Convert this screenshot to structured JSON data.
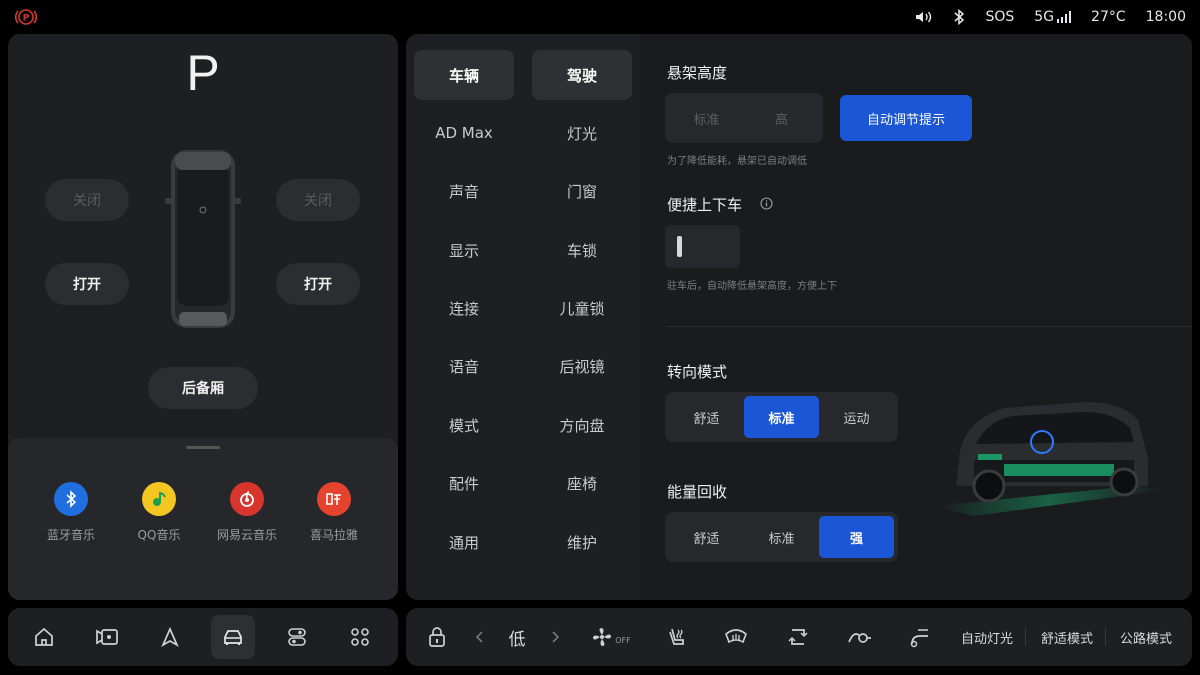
{
  "status": {
    "sos": "SOS",
    "network": "5G",
    "temperature": "27°C",
    "time": "18:00",
    "icons": [
      "parking-brake-icon",
      "volume-icon",
      "bluetooth-icon",
      "signal-icon"
    ]
  },
  "vehicle": {
    "gear": "P",
    "left_upper": "关闭",
    "right_upper": "关闭",
    "left_lower": "打开",
    "right_lower": "打开",
    "trunk": "后备厢"
  },
  "media_apps": [
    {
      "label": "蓝牙音乐",
      "icon": "bluetooth-icon",
      "color": "#1f6fe0"
    },
    {
      "label": "QQ音乐",
      "icon": "qq-music-icon",
      "color": "#f4c622"
    },
    {
      "label": "网易云音乐",
      "icon": "netease-music-icon",
      "color": "#d8362c"
    },
    {
      "label": "喜马拉雅",
      "icon": "ximalaya-icon",
      "color": "#e5432d"
    }
  ],
  "dock": {
    "items": [
      "home-icon",
      "camera-icon",
      "navigation-icon",
      "car-icon",
      "toggle-icon",
      "apps-grid-icon"
    ],
    "active": "car-icon"
  },
  "nav": {
    "col1": [
      "车辆",
      "AD Max",
      "声音",
      "显示",
      "连接",
      "语音",
      "模式",
      "配件",
      "通用"
    ],
    "col2": [
      "驾驶",
      "灯光",
      "门窗",
      "车锁",
      "儿童锁",
      "后视镜",
      "方向盘",
      "座椅",
      "维护"
    ],
    "selected_col1": "车辆",
    "selected_col2": "驾驶"
  },
  "suspension": {
    "title": "悬架高度",
    "options": [
      "标准",
      "高"
    ],
    "auto_button": "自动调节提示",
    "hint": "为了降低能耗，悬架已自动调低"
  },
  "easy_entry": {
    "title": "便捷上下车",
    "hint": "驻车后，自动降低悬架高度，方便上下"
  },
  "steering": {
    "title": "转向模式",
    "options": [
      "舒适",
      "标准",
      "运动"
    ],
    "selected": "标准"
  },
  "regen": {
    "title": "能量回收",
    "options": [
      "舒适",
      "标准",
      "强"
    ],
    "selected": "强"
  },
  "controls": {
    "fan_level": "低",
    "fan_state": "OFF",
    "auto_lights": "自动灯光",
    "comfort_mode": "舒适模式",
    "road_mode": "公路模式"
  },
  "colors": {
    "accent": "#1b56d6",
    "panel": "#1e1f22",
    "background": "#000000"
  }
}
